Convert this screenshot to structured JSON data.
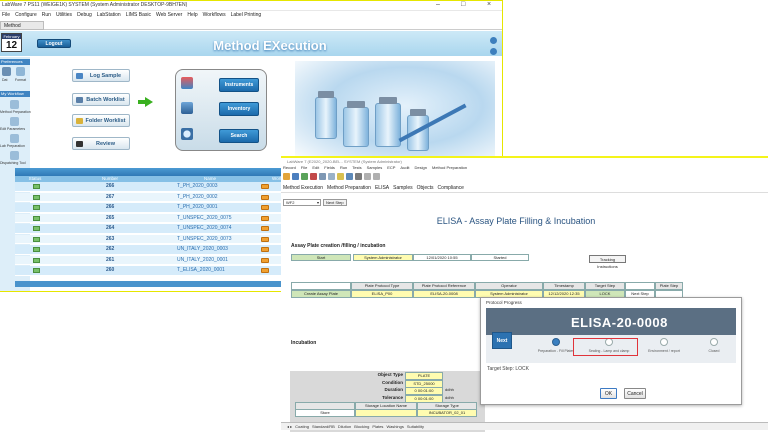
{
  "win1": {
    "title": "LabWare 7 PS11 (WEIGE1K) SYSTEM (System Administrator DESKTOP-9BH7EN)",
    "menu": [
      "File",
      "Configure",
      "Run",
      "Utilities",
      "Debug",
      "LabStation",
      "LIMS Basic",
      "Web Server",
      "Help",
      "Workflows",
      "Label Printing"
    ],
    "tab": "Method EXecution",
    "calendar": {
      "month": "February",
      "day": "12"
    },
    "logout_label": "Logout",
    "heading": "Method EXecution",
    "left_panel": {
      "sections": [
        "Preferences",
        "My Workflow"
      ],
      "captions": [
        "Dat",
        "Format",
        "Method Preparation",
        "Edit Parameters",
        "Lab Preparation",
        "Dispatching Tool"
      ]
    },
    "actions": [
      "Log Sample",
      "Batch Worklist",
      "Folder Worklist",
      "Review"
    ],
    "panel_buttons": [
      "Instruments",
      "Inventory",
      "Search"
    ],
    "table": {
      "title": "Analytical Method",
      "columns": [
        "Status",
        "Number",
        "Name",
        "Worklist"
      ],
      "rows": [
        {
          "number": "266",
          "name": "T_PH_2020_0003"
        },
        {
          "number": "267",
          "name": "T_PH_2020_0002"
        },
        {
          "number": "266",
          "name": "T_PH_2020_0001"
        },
        {
          "number": "265",
          "name": "T_UNSPEC_2020_0075"
        },
        {
          "number": "264",
          "name": "T_UNSPEC_2020_0074"
        },
        {
          "number": "263",
          "name": "T_UNSPEC_2020_0073"
        },
        {
          "number": "262",
          "name": "UN_ITALY_2020_0003"
        },
        {
          "number": "261",
          "name": "UN_ITALY_2020_0001"
        },
        {
          "number": "260",
          "name": "T_ELISA_2020_0001"
        }
      ]
    }
  },
  "win2": {
    "title": "LabWare 7 (E2020_2020-BEL - SYSTEM (System Administrator)",
    "menu": [
      "Record",
      "File",
      "Edit",
      "Fields",
      "Run",
      "Tests",
      "Samples",
      "ECP",
      "Audit",
      "Design",
      "Method Preparation"
    ],
    "nav": [
      "Method Execution",
      "Method Preparation",
      "ELISA",
      "Samples",
      "Objects",
      "Compliance"
    ],
    "combo": "WF2",
    "next_step": "Next Step",
    "heading": "ELISA - Assay Plate Filling & Incubation",
    "section1": "Assay Plate creation /filling / incubation",
    "row1": [
      "Start",
      "System Administrator",
      "12/01/2020 10:55",
      "Started"
    ],
    "track_label": "Tracking Instructions",
    "grid_head": [
      "Plate Protocol Type",
      "Plate Protocol Reference",
      "Operator",
      "Timestamp",
      "Target Step",
      "Plate Step"
    ],
    "grid_row": [
      "Create Assay Plate",
      "ELISA_P00",
      "ELISA-20-0008",
      "System Administrator",
      "12/12/2020 12:35",
      "LOCK",
      "Next Step"
    ],
    "section2": "Incubation",
    "objects": [
      {
        "k": "Object Type",
        "v": "PLATE",
        "u": ""
      },
      {
        "k": "Condition",
        "v": "STD_25000",
        "u": ""
      },
      {
        "k": "Duration",
        "v": "0 00:01:00",
        "u": "ddhh"
      },
      {
        "k": "Tolerance",
        "v": "0 00:01:00",
        "u": "ddhh"
      }
    ],
    "storage_head": [
      "",
      "Storage Location Name",
      "Storage Type"
    ],
    "storage_row": [
      "Store",
      "",
      "INCUBATOR_02_01"
    ],
    "bottom_tabs": [
      "Coating",
      "Standard/RB",
      "Dilution",
      "Blocking",
      "Plates",
      "Washings",
      "Suitability"
    ]
  },
  "dialog": {
    "title": "Protocol Progress",
    "code": "ELISA-20-0008",
    "badge": "Next",
    "steps": [
      "Preparation - Fill Plates",
      "Sealing - Lamp and clamp",
      "Environment / report",
      "Closed"
    ],
    "target": "Target Step: LOCK",
    "ok": "OK",
    "cancel": "Cancel"
  },
  "colors": {
    "accent": "#2f79b6",
    "highlight": "#e0333a",
    "window_border": "#f4f41a",
    "row_a": "#d5ebfa",
    "row_b": "#e9f5fc"
  }
}
